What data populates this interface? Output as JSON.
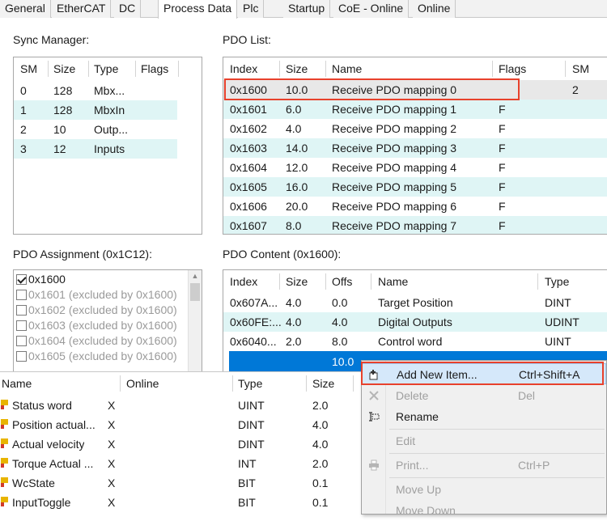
{
  "tabs": [
    "General",
    "EtherCAT",
    "DC",
    "Process Data",
    "Plc",
    "Startup",
    "CoE - Online",
    "Online"
  ],
  "active_tab": "Process Data",
  "sync_manager": {
    "label": "Sync Manager:",
    "columns": [
      "SM",
      "Size",
      "Type",
      "Flags"
    ],
    "rows": [
      {
        "sm": "0",
        "size": "128",
        "type": "Mbx...",
        "flags": ""
      },
      {
        "sm": "1",
        "size": "128",
        "type": "MbxIn",
        "flags": ""
      },
      {
        "sm": "2",
        "size": "10",
        "type": "Outp...",
        "flags": ""
      },
      {
        "sm": "3",
        "size": "12",
        "type": "Inputs",
        "flags": ""
      }
    ]
  },
  "pdo_list": {
    "label": "PDO List:",
    "columns": [
      "Index",
      "Size",
      "Name",
      "Flags",
      "SM"
    ],
    "rows": [
      {
        "index": "0x1600",
        "size": "10.0",
        "name": "Receive PDO mapping 0",
        "flags": "",
        "sm": "2"
      },
      {
        "index": "0x1601",
        "size": "6.0",
        "name": "Receive PDO mapping 1",
        "flags": "F",
        "sm": ""
      },
      {
        "index": "0x1602",
        "size": "4.0",
        "name": "Receive PDO mapping 2",
        "flags": "F",
        "sm": ""
      },
      {
        "index": "0x1603",
        "size": "14.0",
        "name": "Receive PDO mapping 3",
        "flags": "F",
        "sm": ""
      },
      {
        "index": "0x1604",
        "size": "12.0",
        "name": "Receive PDO mapping 4",
        "flags": "F",
        "sm": ""
      },
      {
        "index": "0x1605",
        "size": "16.0",
        "name": "Receive PDO mapping 5",
        "flags": "F",
        "sm": ""
      },
      {
        "index": "0x1606",
        "size": "20.0",
        "name": "Receive PDO mapping 6",
        "flags": "F",
        "sm": ""
      },
      {
        "index": "0x1607",
        "size": "8.0",
        "name": "Receive PDO mapping 7",
        "flags": "F",
        "sm": ""
      }
    ]
  },
  "pdo_assignment": {
    "label": "PDO Assignment (0x1C12):",
    "items": [
      {
        "text": "0x1600",
        "checked": true
      },
      {
        "text": "0x1601 (excluded by 0x1600)",
        "checked": false
      },
      {
        "text": "0x1602 (excluded by 0x1600)",
        "checked": false
      },
      {
        "text": "0x1603 (excluded by 0x1600)",
        "checked": false
      },
      {
        "text": "0x1604 (excluded by 0x1600)",
        "checked": false
      },
      {
        "text": "0x1605 (excluded by 0x1600)",
        "checked": false
      }
    ]
  },
  "pdo_content": {
    "label": "PDO Content (0x1600):",
    "columns": [
      "Index",
      "Size",
      "Offs",
      "Name",
      "Type"
    ],
    "rows": [
      {
        "index": "0x607A...",
        "size": "4.0",
        "offs": "0.0",
        "name": "Target Position",
        "type": "DINT"
      },
      {
        "index": "0x60FE:...",
        "size": "4.0",
        "offs": "4.0",
        "name": "Digital Outputs",
        "type": "UDINT"
      },
      {
        "index": "0x6040...",
        "size": "2.0",
        "offs": "8.0",
        "name": "Control word",
        "type": "UINT"
      }
    ],
    "selected_row_offs": "10.0"
  },
  "variables": {
    "columns": [
      "Name",
      "Online",
      "Type",
      "Size"
    ],
    "rows": [
      {
        "name": "Status word",
        "online": "X",
        "type": "UINT",
        "size": "2.0"
      },
      {
        "name": "Position actual...",
        "online": "X",
        "type": "DINT",
        "size": "4.0"
      },
      {
        "name": "Actual velocity",
        "online": "X",
        "type": "DINT",
        "size": "4.0"
      },
      {
        "name": "Torque Actual ...",
        "online": "X",
        "type": "INT",
        "size": "2.0"
      },
      {
        "name": "WcState",
        "online": "X",
        "type": "BIT",
        "size": "0.1"
      },
      {
        "name": "InputToggle",
        "online": "X",
        "type": "BIT",
        "size": "0.1"
      }
    ]
  },
  "context_menu": {
    "items": [
      {
        "label": "Add New Item...",
        "shortcut": "Ctrl+Shift+A",
        "disabled": false
      },
      {
        "label": "Delete",
        "shortcut": "Del",
        "disabled": true
      },
      {
        "label": "Rename",
        "shortcut": "",
        "disabled": false
      },
      {
        "label": "Edit",
        "shortcut": "",
        "disabled": true
      },
      {
        "label": "Print...",
        "shortcut": "Ctrl+P",
        "disabled": true
      },
      {
        "label": "Move Up",
        "shortcut": "",
        "disabled": true
      },
      {
        "label": "Move Down",
        "shortcut": "",
        "disabled": true
      }
    ]
  },
  "colors": {
    "highlight_red": "#e8412c",
    "row_alt": "#dff5f5",
    "selection_blue": "#0078d7",
    "menu_hover": "#d5e8fa"
  }
}
